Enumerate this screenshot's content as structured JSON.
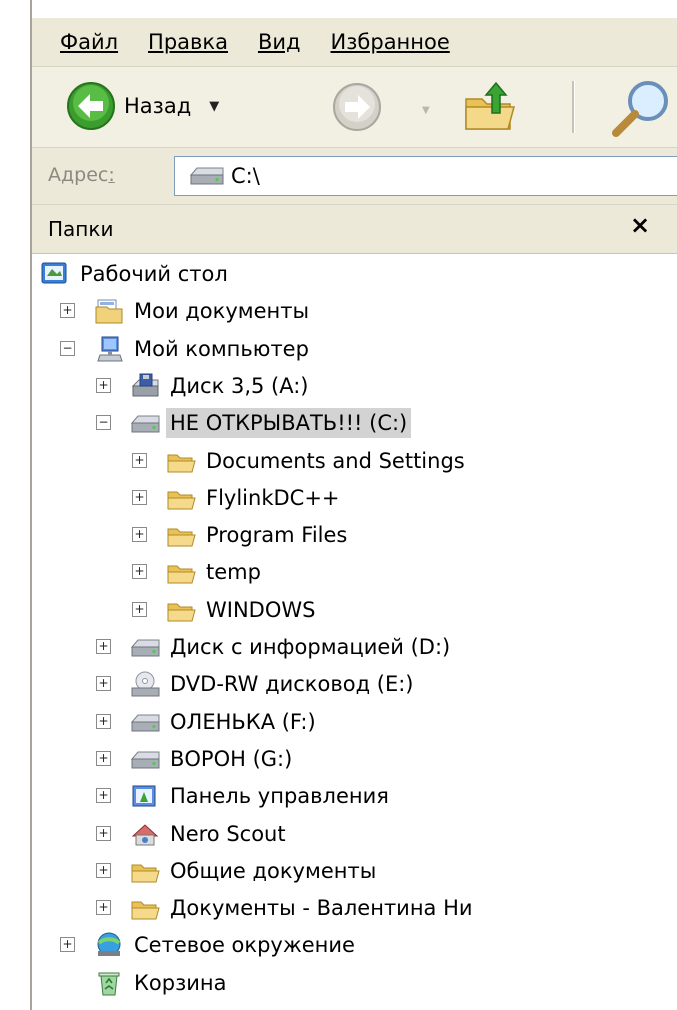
{
  "menu": [
    "Файл",
    "Правка",
    "Вид",
    "Избранное"
  ],
  "toolbar": {
    "back_label": "Назад"
  },
  "address": {
    "label": "Адрес",
    "value": "C:\\"
  },
  "folders_pane": {
    "title": "Папки",
    "close_glyph": "×"
  },
  "tree": [
    {
      "label": "Рабочий стол",
      "icon": "desktop-icon"
    },
    {
      "label": "Мои документы",
      "icon": "my-documents-icon",
      "expander": "+"
    },
    {
      "label": "Мой компьютер",
      "icon": "my-computer-icon",
      "expander": "−"
    },
    {
      "label": "Диск 3,5 (A:)",
      "icon": "floppy-drive-icon",
      "expander": "+"
    },
    {
      "label": "НЕ ОТКРЫВАТЬ!!! (C:)",
      "icon": "hard-drive-icon",
      "expander": "−",
      "selected": true
    },
    {
      "label": "Documents and Settings",
      "icon": "folder-icon",
      "expander": "+"
    },
    {
      "label": "FlylinkDC++",
      "icon": "folder-icon",
      "expander": "+"
    },
    {
      "label": "Program Files",
      "icon": "folder-icon",
      "expander": "+"
    },
    {
      "label": "temp",
      "icon": "folder-icon",
      "expander": "+"
    },
    {
      "label": "WINDOWS",
      "icon": "folder-icon",
      "expander": "+"
    },
    {
      "label": "Диск с информацией (D:)",
      "icon": "hard-drive-icon",
      "expander": "+"
    },
    {
      "label": "DVD-RW дисковод (E:)",
      "icon": "dvd-drive-icon",
      "expander": "+"
    },
    {
      "label": "ОЛЕНЬКА (F:)",
      "icon": "hard-drive-icon",
      "expander": "+"
    },
    {
      "label": "ВОРОН (G:)",
      "icon": "hard-drive-icon",
      "expander": "+"
    },
    {
      "label": "Панель управления",
      "icon": "control-panel-icon",
      "expander": "+"
    },
    {
      "label": "Nero Scout",
      "icon": "nero-scout-icon",
      "expander": "+"
    },
    {
      "label": "Общие документы",
      "icon": "folder-icon",
      "expander": "+"
    },
    {
      "label": "Документы - Валентина Ни",
      "icon": "folder-icon",
      "expander": "+"
    },
    {
      "label": "Сетевое окружение",
      "icon": "network-icon",
      "expander": "+"
    },
    {
      "label": "Корзина",
      "icon": "recycle-bin-icon"
    }
  ]
}
